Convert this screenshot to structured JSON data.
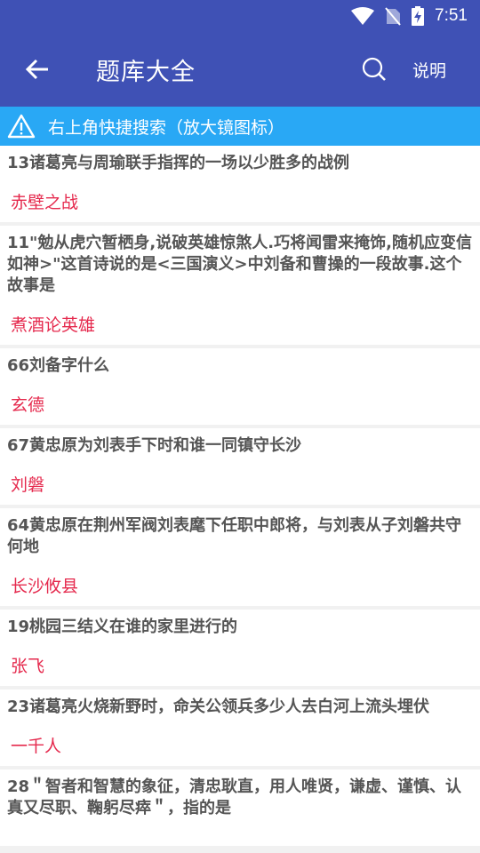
{
  "status": {
    "time": "7:51"
  },
  "appbar": {
    "title": "题库大全",
    "help_label": "说明"
  },
  "notice": {
    "text": "右上角快捷搜索（放大镜图标）"
  },
  "items": [
    {
      "q": "13诸葛亮与周瑜联手指挥的一场以少胜多的战例",
      "a": "赤壁之战"
    },
    {
      "q": "11\"勉从虎穴暂栖身,说破英雄惊煞人.巧将闻雷来掩饰,随机应变信如神>\"这首诗说的是<三国演义>中刘备和曹操的一段故事.这个故事是",
      "a": "煮酒论英雄"
    },
    {
      "q": "66刘备字什么",
      "a": "玄德"
    },
    {
      "q": "67黄忠原为刘表手下时和谁一同镇守长沙",
      "a": "刘磐"
    },
    {
      "q": "64黄忠原在荆州军阀刘表麾下任职中郎将，与刘表从子刘磐共守何地",
      "a": "长沙攸县"
    },
    {
      "q": "19桃园三结义在谁的家里进行的",
      "a": "张飞"
    },
    {
      "q": "23诸葛亮火烧新野时，命关公领兵多少人去白河上流头埋伏",
      "a": "一千人"
    },
    {
      "q": "28＂智者和智慧的象征，清忠耿直，用人唯贤，谦虚、谨慎、认真又尽职、鞠躬尽瘁＂，指的是",
      "a": ""
    }
  ]
}
